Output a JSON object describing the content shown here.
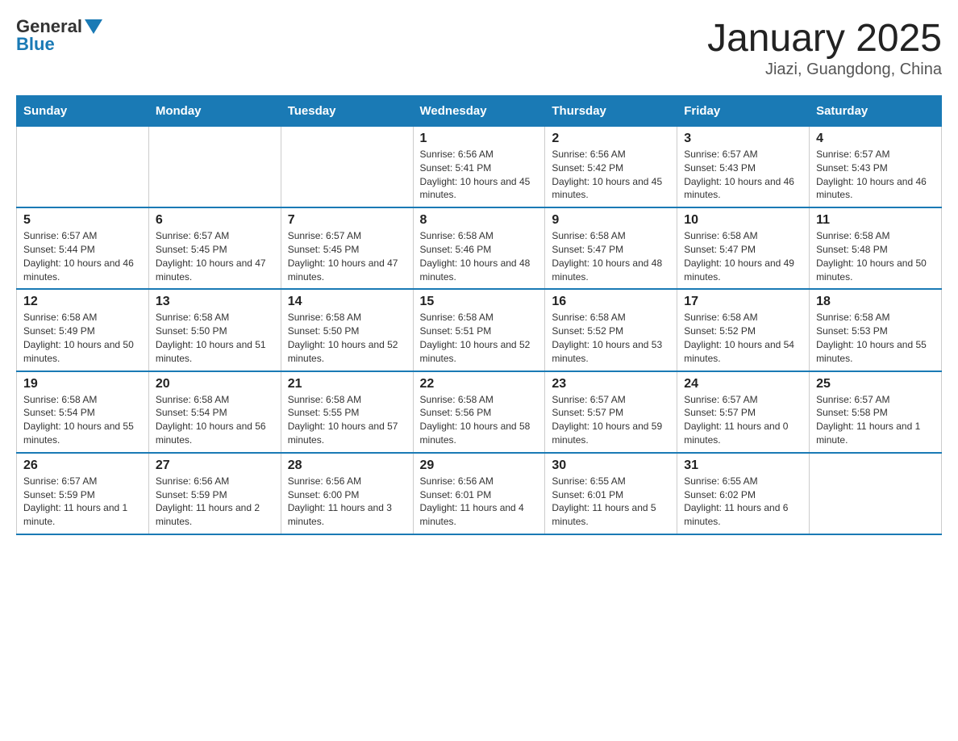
{
  "header": {
    "logo": {
      "general": "General",
      "blue": "Blue"
    },
    "title": "January 2025",
    "subtitle": "Jiazi, Guangdong, China"
  },
  "days_of_week": [
    "Sunday",
    "Monday",
    "Tuesday",
    "Wednesday",
    "Thursday",
    "Friday",
    "Saturday"
  ],
  "weeks": [
    {
      "days": [
        {
          "number": "",
          "info": ""
        },
        {
          "number": "",
          "info": ""
        },
        {
          "number": "",
          "info": ""
        },
        {
          "number": "1",
          "info": "Sunrise: 6:56 AM\nSunset: 5:41 PM\nDaylight: 10 hours and 45 minutes."
        },
        {
          "number": "2",
          "info": "Sunrise: 6:56 AM\nSunset: 5:42 PM\nDaylight: 10 hours and 45 minutes."
        },
        {
          "number": "3",
          "info": "Sunrise: 6:57 AM\nSunset: 5:43 PM\nDaylight: 10 hours and 46 minutes."
        },
        {
          "number": "4",
          "info": "Sunrise: 6:57 AM\nSunset: 5:43 PM\nDaylight: 10 hours and 46 minutes."
        }
      ]
    },
    {
      "days": [
        {
          "number": "5",
          "info": "Sunrise: 6:57 AM\nSunset: 5:44 PM\nDaylight: 10 hours and 46 minutes."
        },
        {
          "number": "6",
          "info": "Sunrise: 6:57 AM\nSunset: 5:45 PM\nDaylight: 10 hours and 47 minutes."
        },
        {
          "number": "7",
          "info": "Sunrise: 6:57 AM\nSunset: 5:45 PM\nDaylight: 10 hours and 47 minutes."
        },
        {
          "number": "8",
          "info": "Sunrise: 6:58 AM\nSunset: 5:46 PM\nDaylight: 10 hours and 48 minutes."
        },
        {
          "number": "9",
          "info": "Sunrise: 6:58 AM\nSunset: 5:47 PM\nDaylight: 10 hours and 48 minutes."
        },
        {
          "number": "10",
          "info": "Sunrise: 6:58 AM\nSunset: 5:47 PM\nDaylight: 10 hours and 49 minutes."
        },
        {
          "number": "11",
          "info": "Sunrise: 6:58 AM\nSunset: 5:48 PM\nDaylight: 10 hours and 50 minutes."
        }
      ]
    },
    {
      "days": [
        {
          "number": "12",
          "info": "Sunrise: 6:58 AM\nSunset: 5:49 PM\nDaylight: 10 hours and 50 minutes."
        },
        {
          "number": "13",
          "info": "Sunrise: 6:58 AM\nSunset: 5:50 PM\nDaylight: 10 hours and 51 minutes."
        },
        {
          "number": "14",
          "info": "Sunrise: 6:58 AM\nSunset: 5:50 PM\nDaylight: 10 hours and 52 minutes."
        },
        {
          "number": "15",
          "info": "Sunrise: 6:58 AM\nSunset: 5:51 PM\nDaylight: 10 hours and 52 minutes."
        },
        {
          "number": "16",
          "info": "Sunrise: 6:58 AM\nSunset: 5:52 PM\nDaylight: 10 hours and 53 minutes."
        },
        {
          "number": "17",
          "info": "Sunrise: 6:58 AM\nSunset: 5:52 PM\nDaylight: 10 hours and 54 minutes."
        },
        {
          "number": "18",
          "info": "Sunrise: 6:58 AM\nSunset: 5:53 PM\nDaylight: 10 hours and 55 minutes."
        }
      ]
    },
    {
      "days": [
        {
          "number": "19",
          "info": "Sunrise: 6:58 AM\nSunset: 5:54 PM\nDaylight: 10 hours and 55 minutes."
        },
        {
          "number": "20",
          "info": "Sunrise: 6:58 AM\nSunset: 5:54 PM\nDaylight: 10 hours and 56 minutes."
        },
        {
          "number": "21",
          "info": "Sunrise: 6:58 AM\nSunset: 5:55 PM\nDaylight: 10 hours and 57 minutes."
        },
        {
          "number": "22",
          "info": "Sunrise: 6:58 AM\nSunset: 5:56 PM\nDaylight: 10 hours and 58 minutes."
        },
        {
          "number": "23",
          "info": "Sunrise: 6:57 AM\nSunset: 5:57 PM\nDaylight: 10 hours and 59 minutes."
        },
        {
          "number": "24",
          "info": "Sunrise: 6:57 AM\nSunset: 5:57 PM\nDaylight: 11 hours and 0 minutes."
        },
        {
          "number": "25",
          "info": "Sunrise: 6:57 AM\nSunset: 5:58 PM\nDaylight: 11 hours and 1 minute."
        }
      ]
    },
    {
      "days": [
        {
          "number": "26",
          "info": "Sunrise: 6:57 AM\nSunset: 5:59 PM\nDaylight: 11 hours and 1 minute."
        },
        {
          "number": "27",
          "info": "Sunrise: 6:56 AM\nSunset: 5:59 PM\nDaylight: 11 hours and 2 minutes."
        },
        {
          "number": "28",
          "info": "Sunrise: 6:56 AM\nSunset: 6:00 PM\nDaylight: 11 hours and 3 minutes."
        },
        {
          "number": "29",
          "info": "Sunrise: 6:56 AM\nSunset: 6:01 PM\nDaylight: 11 hours and 4 minutes."
        },
        {
          "number": "30",
          "info": "Sunrise: 6:55 AM\nSunset: 6:01 PM\nDaylight: 11 hours and 5 minutes."
        },
        {
          "number": "31",
          "info": "Sunrise: 6:55 AM\nSunset: 6:02 PM\nDaylight: 11 hours and 6 minutes."
        },
        {
          "number": "",
          "info": ""
        }
      ]
    }
  ]
}
